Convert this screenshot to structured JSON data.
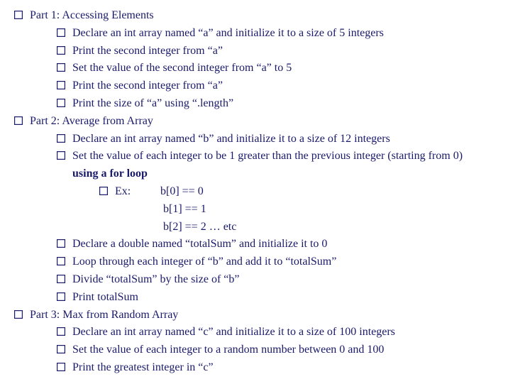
{
  "parts": [
    {
      "title": "Part 1: Accessing Elements",
      "items": [
        "Declare an int array named “a” and initialize it to a size of 5 integers",
        "Print the second integer from “a”",
        "Set the value of the second integer from “a” to 5",
        "Print the second integer from “a”",
        "Print the size of “a” using “.length”"
      ]
    },
    {
      "title": "Part 2: Average from Array",
      "items_pre": [
        "Declare an int array named “b” and initialize it to a size of 12 integers"
      ],
      "sequential_item": {
        "line1": "Set the value of each integer to be 1 greater than the previous integer (starting from 0)",
        "line2": "using a for loop"
      },
      "example": {
        "label": "Ex:",
        "lines": [
          "b[0] == 0",
          "b[1] == 1",
          "b[2] == 2 … etc"
        ]
      },
      "items_post": [
        "Declare a double named “totalSum” and initialize it to 0",
        "Loop through each integer of “b” and add it to “totalSum”",
        "Divide “totalSum” by the size of “b”",
        "Print totalSum"
      ]
    },
    {
      "title": "Part 3: Max from Random Array",
      "items": [
        "Declare an int array named “c” and initialize it to a size of 100 integers",
        "Set the value of each integer to a random number between 0 and 100",
        "Print the greatest integer in “c”"
      ]
    }
  ]
}
